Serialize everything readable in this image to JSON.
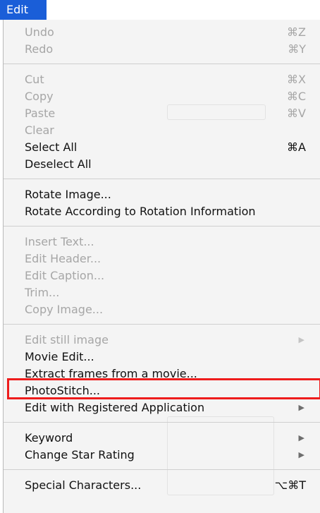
{
  "menu_bar": {
    "title": "Edit"
  },
  "menu": {
    "groups": [
      [
        {
          "label": "Undo",
          "shortcut": "⌘Z",
          "enabled": false
        },
        {
          "label": "Redo",
          "shortcut": "⌘Y",
          "enabled": false
        }
      ],
      [
        {
          "label": "Cut",
          "shortcut": "⌘X",
          "enabled": false
        },
        {
          "label": "Copy",
          "shortcut": "⌘C",
          "enabled": false
        },
        {
          "label": "Paste",
          "shortcut": "⌘V",
          "enabled": false
        },
        {
          "label": "Clear",
          "shortcut": "",
          "enabled": false
        },
        {
          "label": "Select All",
          "shortcut": "⌘A",
          "enabled": true
        },
        {
          "label": "Deselect All",
          "shortcut": "",
          "enabled": true
        }
      ],
      [
        {
          "label": "Rotate Image...",
          "shortcut": "",
          "enabled": true
        },
        {
          "label": "Rotate According to Rotation Information",
          "shortcut": "",
          "enabled": true
        }
      ],
      [
        {
          "label": "Insert Text...",
          "shortcut": "",
          "enabled": false
        },
        {
          "label": "Edit Header...",
          "shortcut": "",
          "enabled": false
        },
        {
          "label": "Edit Caption...",
          "shortcut": "",
          "enabled": false
        },
        {
          "label": "Trim...",
          "shortcut": "",
          "enabled": false
        },
        {
          "label": "Copy Image...",
          "shortcut": "",
          "enabled": false
        }
      ],
      [
        {
          "label": "Edit still image",
          "shortcut": "",
          "enabled": false,
          "submenu": true
        },
        {
          "label": "Movie Edit...",
          "shortcut": "",
          "enabled": true,
          "highlighted": true
        },
        {
          "label": "Extract frames from a movie...",
          "shortcut": "",
          "enabled": true
        },
        {
          "label": "PhotoStitch...",
          "shortcut": "",
          "enabled": true
        },
        {
          "label": "Edit with Registered Application",
          "shortcut": "",
          "enabled": true,
          "submenu": true
        }
      ],
      [
        {
          "label": "Keyword",
          "shortcut": "",
          "enabled": true,
          "submenu": true
        },
        {
          "label": "Change Star Rating",
          "shortcut": "",
          "enabled": true,
          "submenu": true
        }
      ],
      [
        {
          "label": "Special Characters...",
          "shortcut": "⌥⌘T",
          "enabled": true
        }
      ]
    ]
  },
  "colors": {
    "menu_title_bg": "#1a5ed8",
    "highlight_border": "#ee1c1c",
    "disabled_text": "#a6a6a6",
    "enabled_text": "#111111"
  }
}
